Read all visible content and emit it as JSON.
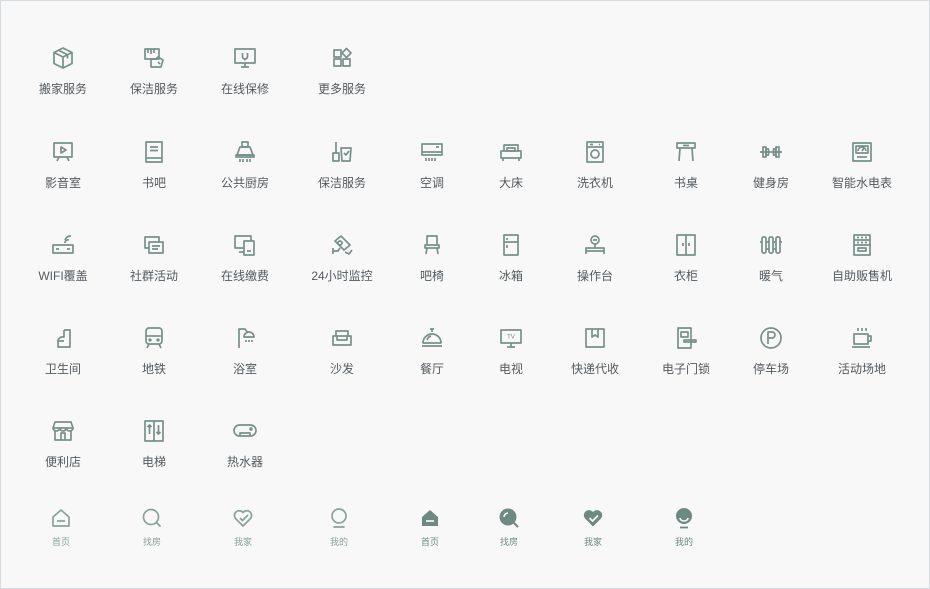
{
  "colors": {
    "icon": "#77908a",
    "label": "#555a5e",
    "tab_label": "#8aa19a",
    "border": "#d6dde2",
    "background": "#f8f8f8"
  },
  "row1": [
    {
      "label": "搬家服务",
      "icon": "package-icon"
    },
    {
      "label": "保洁服务",
      "icon": "cleaning-hand-icon"
    },
    {
      "label": "在线保修",
      "icon": "repair-monitor-icon"
    },
    {
      "label": "更多服务",
      "icon": "more-grid-icon"
    }
  ],
  "row2": [
    {
      "label": "影音室",
      "icon": "media-room-icon"
    },
    {
      "label": "书吧",
      "icon": "book-icon"
    },
    {
      "label": "公共厨房",
      "icon": "range-hood-icon"
    },
    {
      "label": "保洁服务",
      "icon": "broom-bucket-icon"
    },
    {
      "label": "空调",
      "icon": "air-conditioner-icon"
    },
    {
      "label": "大床",
      "icon": "bed-icon"
    },
    {
      "label": "洗衣机",
      "icon": "washing-machine-icon"
    },
    {
      "label": "书桌",
      "icon": "desk-icon"
    },
    {
      "label": "健身房",
      "icon": "dumbbell-icon"
    },
    {
      "label": "智能水电表",
      "icon": "smart-meter-icon"
    }
  ],
  "row3": [
    {
      "label": "WIFI覆盖",
      "icon": "wifi-router-icon"
    },
    {
      "label": "社群活动",
      "icon": "community-icon"
    },
    {
      "label": "在线缴费",
      "icon": "payment-devices-icon"
    },
    {
      "label": "24小时监控",
      "icon": "camera-icon"
    },
    {
      "label": "吧椅",
      "icon": "chair-icon"
    },
    {
      "label": "冰箱",
      "icon": "fridge-icon"
    },
    {
      "label": "操作台",
      "icon": "workbench-icon"
    },
    {
      "label": "衣柜",
      "icon": "wardrobe-icon"
    },
    {
      "label": "暖气",
      "icon": "radiator-icon"
    },
    {
      "label": "自助贩售机",
      "icon": "vending-machine-icon"
    }
  ],
  "row4": [
    {
      "label": "卫生间",
      "icon": "toilet-icon"
    },
    {
      "label": "地铁",
      "icon": "subway-icon"
    },
    {
      "label": "浴室",
      "icon": "shower-icon"
    },
    {
      "label": "沙发",
      "icon": "sofa-icon"
    },
    {
      "label": "餐厅",
      "icon": "cloche-icon"
    },
    {
      "label": "电视",
      "icon": "tv-icon"
    },
    {
      "label": "快递代收",
      "icon": "parcel-icon"
    },
    {
      "label": "电子门锁",
      "icon": "door-lock-icon"
    },
    {
      "label": "停车场",
      "icon": "parking-icon"
    },
    {
      "label": "活动场地",
      "icon": "coffee-cup-icon"
    }
  ],
  "row5": [
    {
      "label": "便利店",
      "icon": "store-icon"
    },
    {
      "label": "电梯",
      "icon": "elevator-icon"
    },
    {
      "label": "热水器",
      "icon": "water-heater-icon"
    }
  ],
  "tabs_outline": [
    {
      "label": "首页",
      "icon": "home-icon"
    },
    {
      "label": "找房",
      "icon": "search-icon"
    },
    {
      "label": "我家",
      "icon": "heart-check-icon"
    },
    {
      "label": "我的",
      "icon": "user-icon"
    }
  ],
  "tabs_filled": [
    {
      "label": "首页",
      "icon": "home-filled-icon"
    },
    {
      "label": "找房",
      "icon": "search-filled-icon"
    },
    {
      "label": "我家",
      "icon": "heart-check-filled-icon"
    },
    {
      "label": "我的",
      "icon": "user-filled-icon"
    }
  ]
}
